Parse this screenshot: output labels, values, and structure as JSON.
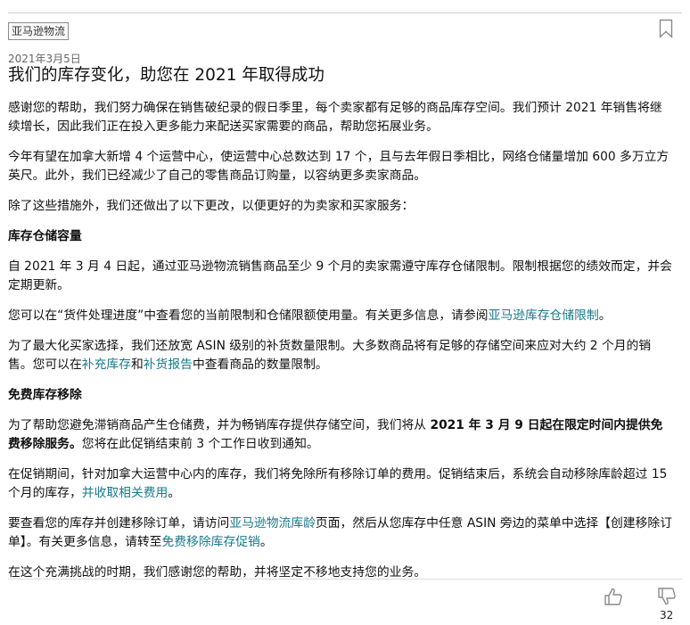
{
  "post": {
    "tag": "亚马逊物流",
    "date": "2021年3月5日",
    "title": "我们的库存变化，助您在 2021 年取得成功"
  },
  "content": {
    "p1": "感谢您的帮助，我们努力确保在销售破纪录的假日季里，每个卖家都有足够的商品库存空间。我们预计 2021 年销售将继续增长，因此我们正在投入更多能力来配送买家需要的商品，帮助您拓展业务。",
    "p2": "今年有望在加拿大新增 4 个运营中心，使运营中心总数达到 17 个，且与去年假日季相比，网络仓储量增加 600 多万立方英尺。此外，我们已经减少了自己的零售商品订购量，以容纳更多卖家商品。",
    "p3": "除了这些措施外，我们还做出了以下更改，以便更好的为卖家和买家服务：",
    "h1": "库存仓储容量",
    "p4": "自 2021 年 3 月 4 日起，通过亚马逊物流销售商品至少 9 个月的卖家需遵守库存仓储限制。限制根据您的绩效而定，并会定期更新。",
    "p5_pre": "您可以在“货件处理进度”中查看您的当前限制和仓储限额使用量。有关更多信息，请参阅",
    "p5_link": "亚马逊库存仓储限制",
    "p5_post": "。",
    "p6_pre": "为了最大化买家选择，我们还放宽 ASIN 级别的补货数量限制。大多数商品将有足够的存储空间来应对大约 2 个月的销售。您可以在",
    "p6_link1": "补充库存",
    "p6_mid": "和",
    "p6_link2": "补货报告",
    "p6_post": "中查看商品的数量限制。",
    "h2": "免费库存移除",
    "p7_pre": "为了帮助您避免滞销商品产生仓储费，并为畅销库存提供存储空间，我们将从 ",
    "p7_bold": "2021 年 3 月 9 日起在限定时间内提供免费移除服务。",
    "p7_post": "您将在此促销结束前 3 个工作日收到通知。",
    "p8_pre": "在促销期间，针对加拿大运营中心内的库存，我们将免除所有移除订单的费用。促销结束后，系统会自动移除库龄超过 15 个月的库存，",
    "p8_link": "并收取相关费用",
    "p8_post": "。",
    "p9_pre": "要查看您的库存并创建移除订单，请访问",
    "p9_link1": "亚马逊物流库龄",
    "p9_mid": "页面，然后从您库存中任意 ASIN 旁边的菜单中选择【创建移除订单】。有关更多信息，请转至",
    "p9_link2": "免费移除库存促销",
    "p9_post": "。",
    "p10": "在这个充满挑战的时期，我们感谢您的帮助，并将坚定不移地支持您的业务。"
  },
  "footer": {
    "dislike_count": "32"
  },
  "icons": {
    "bookmark": "bookmark-icon",
    "like": "thumbs-up-icon",
    "dislike": "thumbs-down-icon"
  },
  "colors": {
    "link": "#1a7a8a"
  }
}
